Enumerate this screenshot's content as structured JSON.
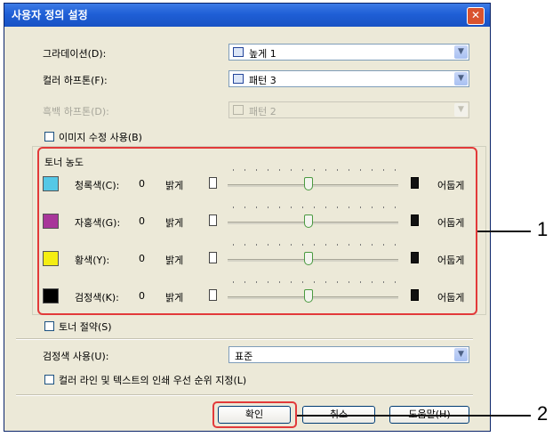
{
  "dialog": {
    "title": "사용자 정의 설정",
    "close_glyph": "✕"
  },
  "gradation": {
    "label": "그라데이션(D):",
    "value": "높게 1"
  },
  "color_halftone": {
    "label": "컬러 하프톤(F):",
    "value": "패턴 3"
  },
  "mono_halftone": {
    "label": "흑백 하프톤(D):",
    "value": "패턴 2"
  },
  "image_correction": {
    "label": "이미지 수정 사용(B)",
    "checked": false
  },
  "toner_density": {
    "group_label": "토너 농도",
    "light_label": "밝게",
    "dark_label": "어둡게",
    "rows": [
      {
        "label": "청록색(C):",
        "value": "0",
        "color": "#55c8e6"
      },
      {
        "label": "자홍색(G):",
        "value": "0",
        "color": "#a8379a"
      },
      {
        "label": "황색(Y):",
        "value": "0",
        "color": "#f4ee12"
      },
      {
        "label": "검정색(K):",
        "value": "0",
        "color": "#000000"
      }
    ]
  },
  "toner_save": {
    "label": "토너 절약(S)",
    "checked": false
  },
  "black_use": {
    "label": "검정색 사용(U):",
    "value": "표준"
  },
  "priority": {
    "label": "컬러 라인 및 텍스트의 인쇄 우선 순위 지정(L)",
    "checked": false
  },
  "buttons": {
    "ok": "확인",
    "cancel": "취소",
    "help": "도움말(H)"
  },
  "callouts": {
    "one": "1",
    "two": "2"
  },
  "accent_color": "#e23a3a"
}
